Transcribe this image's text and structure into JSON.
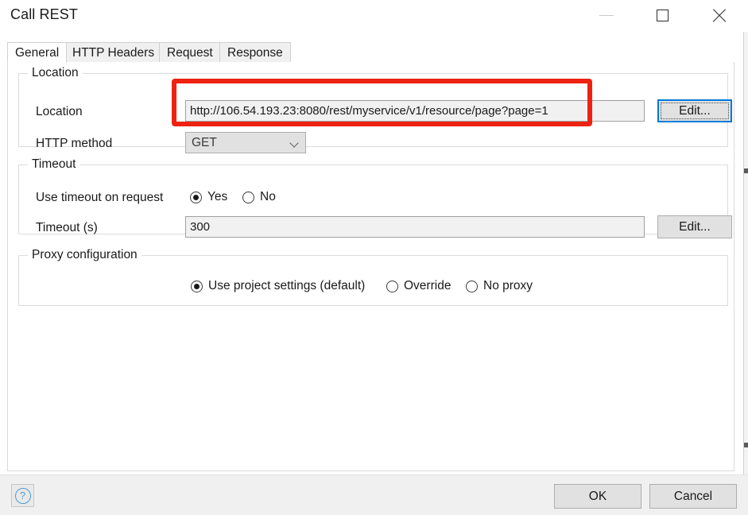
{
  "window": {
    "title": "Call REST",
    "controls": {
      "minimize": "minimize-icon",
      "maximize": "maximize-icon",
      "close": "close-icon"
    }
  },
  "tabs": [
    {
      "label": "General",
      "selected": true
    },
    {
      "label": "HTTP Headers",
      "selected": false
    },
    {
      "label": "Request",
      "selected": false
    },
    {
      "label": "Response",
      "selected": false
    }
  ],
  "location_group": {
    "title": "Location",
    "location_label": "Location",
    "location_value": "http://106.54.193.23:8080/rest/myservice/v1/resource/page?page=1",
    "location_edit_button": "Edit...",
    "method_label": "HTTP method",
    "method_value": "GET"
  },
  "timeout_group": {
    "title": "Timeout",
    "use_timeout_label": "Use timeout on request",
    "yes_label": "Yes",
    "no_label": "No",
    "use_timeout_selected": "Yes",
    "timeout_label": "Timeout (s)",
    "timeout_value": "300",
    "timeout_edit_button": "Edit..."
  },
  "proxy_group": {
    "title": "Proxy configuration",
    "options": [
      {
        "label": "Use project settings (default)",
        "selected": true
      },
      {
        "label": "Override",
        "selected": false
      },
      {
        "label": "No proxy",
        "selected": false
      }
    ]
  },
  "footer": {
    "help_button": "?",
    "ok_button": "OK",
    "cancel_button": "Cancel"
  },
  "annotation": {
    "color": "#ee2211",
    "target": "location-input-row"
  }
}
